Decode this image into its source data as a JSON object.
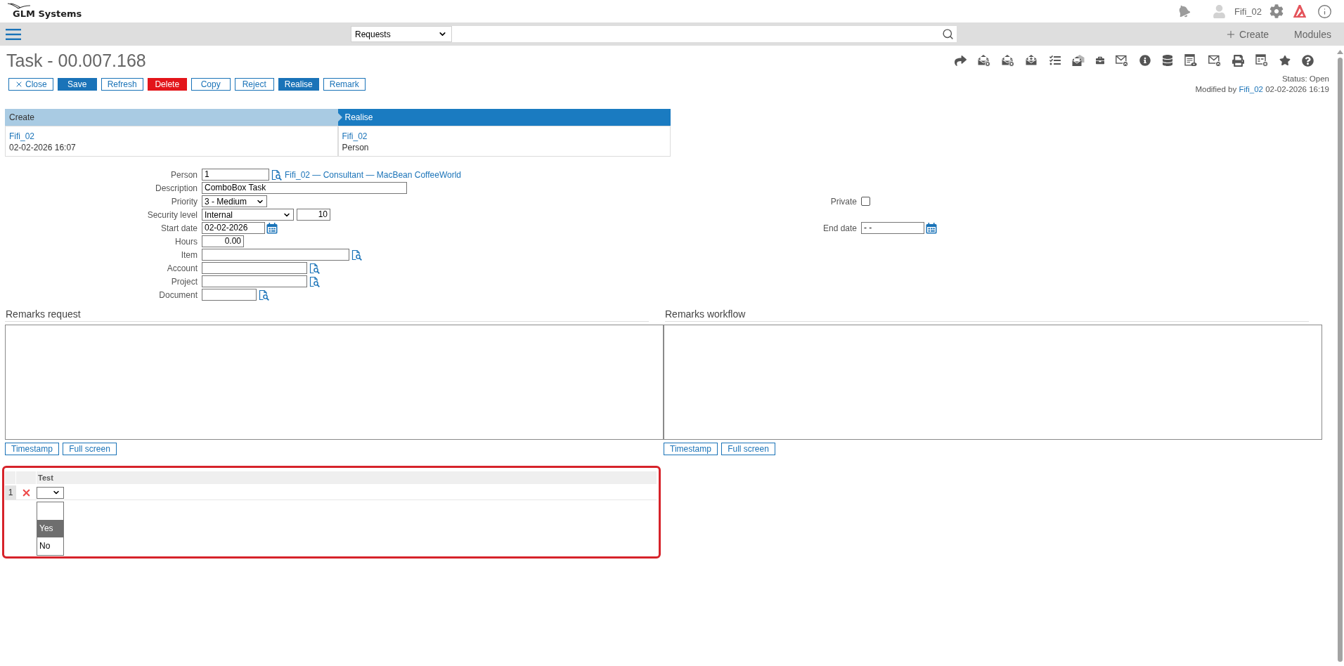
{
  "header": {
    "logo": "GLM Systems",
    "user": "Fifi_02"
  },
  "navbar": {
    "module": "Requests",
    "actions": [
      {
        "kind": "create",
        "label": "Create"
      },
      {
        "kind": "plain",
        "label": "Modules"
      }
    ]
  },
  "page": {
    "title": "Task - 00.007.168",
    "status": "Status: Open",
    "modified": {
      "prefix": "Modified by",
      "user": "Fifi_02",
      "time": "02-02-2026 16:19"
    }
  },
  "buttons": [
    {
      "label": "Close",
      "kind": "close"
    },
    {
      "label": "Save",
      "kind": "primary"
    },
    {
      "label": "Refresh",
      "kind": "outline"
    },
    {
      "label": "Delete",
      "kind": "danger"
    },
    {
      "label": "Copy",
      "kind": "outline"
    },
    {
      "label": "Reject",
      "kind": "outline"
    },
    {
      "label": "Realise",
      "kind": "primary"
    },
    {
      "label": "Remark",
      "kind": "outline"
    }
  ],
  "workflow": [
    {
      "step": "Create",
      "current": false,
      "user": "Fifi_02",
      "detail": "02-02-2026 16:07"
    },
    {
      "step": "Realise",
      "current": true,
      "user": "Fifi_02",
      "detail": "Person"
    }
  ],
  "form": {
    "rows": [
      {
        "left": {
          "label": "Person",
          "kind": "lookup",
          "value": "1",
          "link": "Fifi_02 — Consultant — MacBean CoffeeWorld"
        }
      },
      {
        "left": {
          "label": "Description",
          "kind": "text",
          "value": "ComboBox Task"
        }
      },
      {
        "left": {
          "label": "Priority",
          "kind": "select",
          "value": "3 - Medium"
        },
        "right": {
          "label": "Private",
          "kind": "checkbox",
          "checked": false
        }
      },
      {
        "left": {
          "label": "Security level",
          "kind": "select",
          "value": "Internal",
          "number": "10"
        }
      },
      {
        "left": {
          "label": "Start date",
          "kind": "date",
          "value": "02-02-2026"
        },
        "right": {
          "label": "End date",
          "kind": "date",
          "value": "- -"
        }
      },
      {
        "left": {
          "label": "Hours",
          "kind": "number",
          "value": "0.00"
        }
      },
      {
        "left": {
          "label": "Item",
          "kind": "lookup"
        }
      },
      {
        "left": {
          "label": "Account",
          "kind": "lookup"
        }
      },
      {
        "left": {
          "label": "Project",
          "kind": "lookup"
        }
      },
      {
        "left": {
          "label": "Document",
          "kind": "lookup"
        }
      }
    ]
  },
  "remarks": [
    {
      "title": "Remarks request",
      "buttons": [
        "Timestamp",
        "Full screen"
      ]
    },
    {
      "title": "Remarks workflow",
      "buttons": [
        "Timestamp",
        "Full screen"
      ]
    }
  ],
  "grid": {
    "highlighted": true,
    "columns": [
      "Test"
    ],
    "rows": [
      {
        "number": "1",
        "dropdown": {
          "open": true,
          "options": [
            {
              "selected": false
            },
            {
              "label": "Yes",
              "selected": true
            },
            {
              "label": "No",
              "selected": false
            }
          ]
        }
      }
    ]
  }
}
